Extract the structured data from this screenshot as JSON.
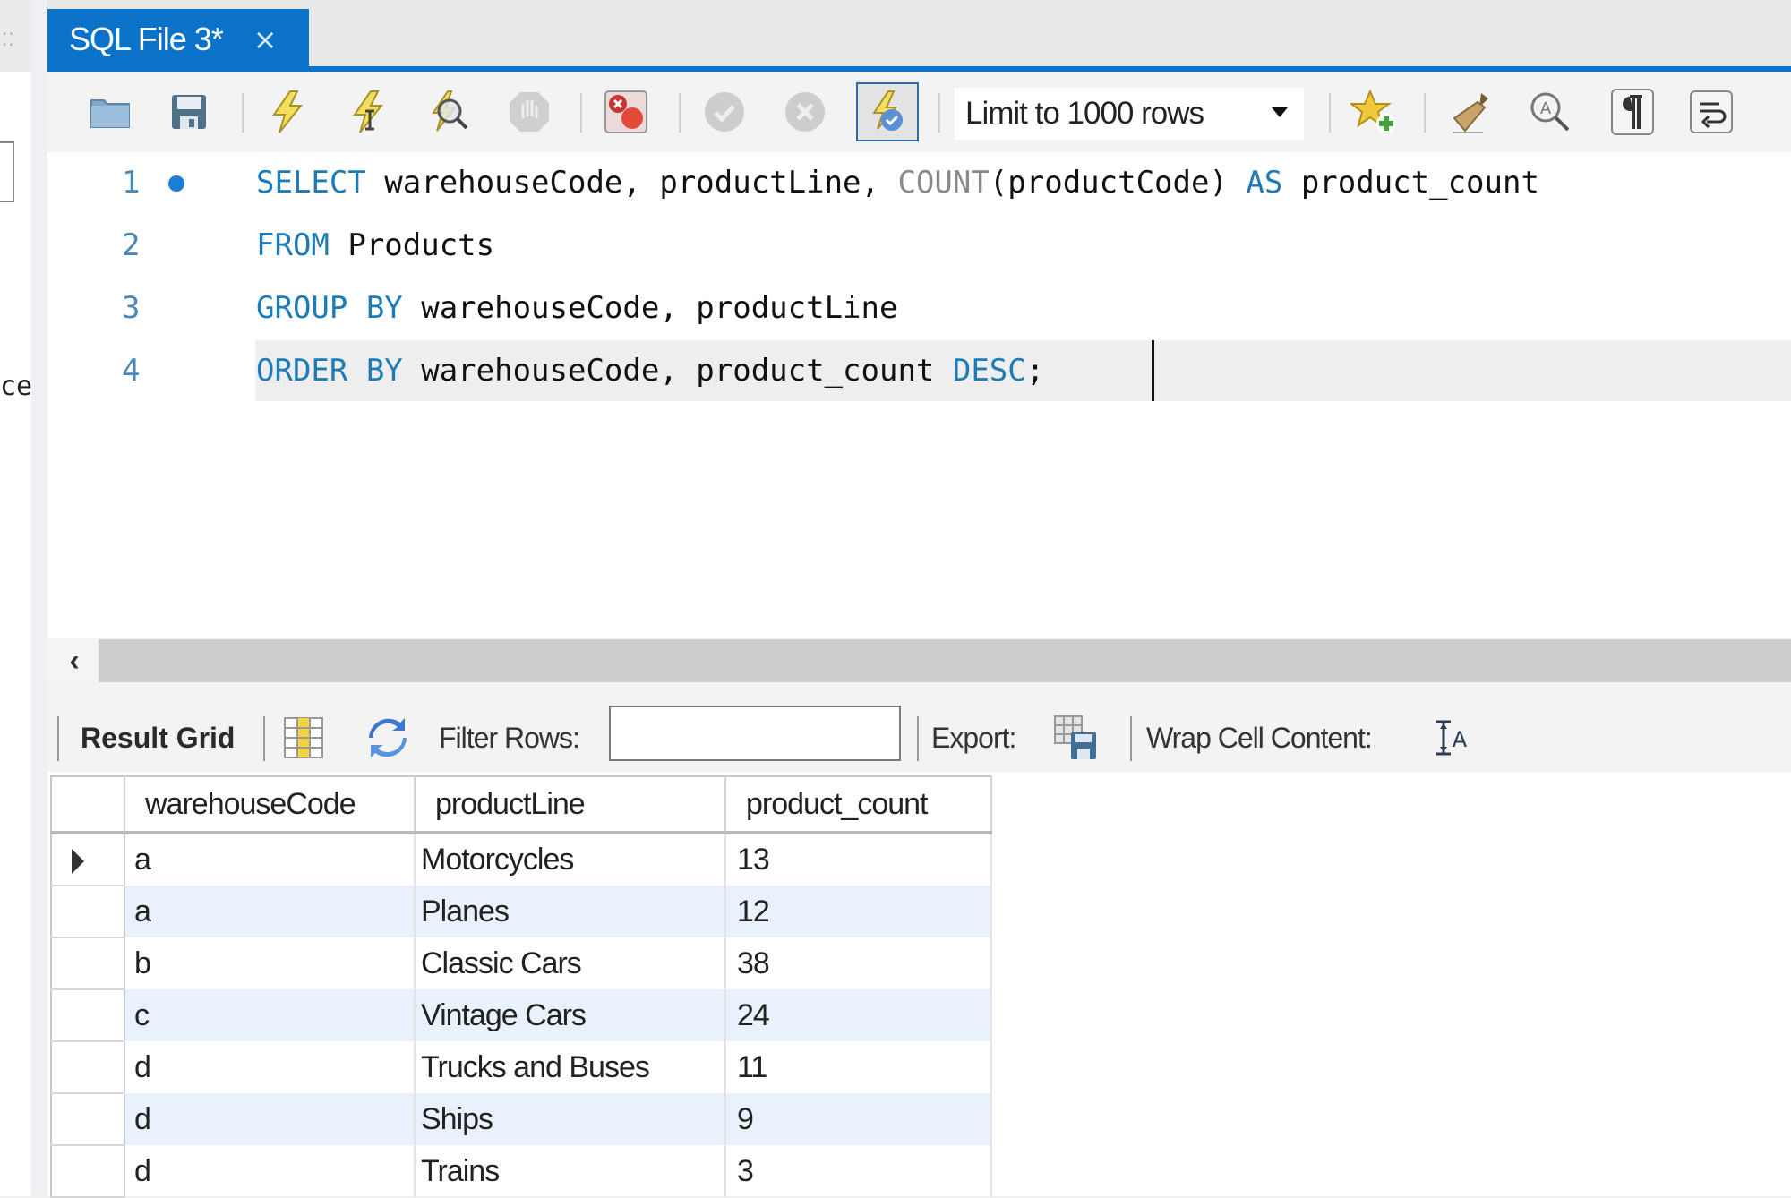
{
  "sidebar": {
    "grip": "⁚⁚",
    "partial_text": "ce"
  },
  "tab": {
    "title": "SQL File 3*",
    "close": "×"
  },
  "toolbar": {
    "icons": [
      "open-file-icon",
      "save-icon",
      "execute-icon",
      "execute-current-icon",
      "explain-icon",
      "stop-icon",
      "toggle-error-icon",
      "commit-icon",
      "rollback-icon",
      "autocommit-icon",
      "add-snippet-icon",
      "beautify-icon",
      "find-icon",
      "invisible-chars-icon",
      "word-wrap-icon"
    ],
    "limit_label": "Limit to 1000 rows"
  },
  "editor": {
    "line_numbers": [
      "1",
      "2",
      "3",
      "4"
    ],
    "lines": [
      [
        {
          "t": "SELECT",
          "c": "kw"
        },
        {
          "t": " warehouseCode, productLine, ",
          "c": ""
        },
        {
          "t": "COUNT",
          "c": "fn"
        },
        {
          "t": "(productCode) ",
          "c": ""
        },
        {
          "t": "AS",
          "c": "kw"
        },
        {
          "t": " product_count",
          "c": ""
        }
      ],
      [
        {
          "t": "FROM",
          "c": "kw"
        },
        {
          "t": " Products",
          "c": ""
        }
      ],
      [
        {
          "t": "GROUP BY",
          "c": "kw"
        },
        {
          "t": " warehouseCode, productLine",
          "c": ""
        }
      ],
      [
        {
          "t": "ORDER BY",
          "c": "kw"
        },
        {
          "t": " warehouseCode, product_count ",
          "c": ""
        },
        {
          "t": "DESC",
          "c": "kw"
        },
        {
          "t": ";",
          "c": ""
        }
      ]
    ]
  },
  "results": {
    "result_grid_label": "Result Grid",
    "filter_label": "Filter Rows:",
    "filter_value": "",
    "export_label": "Export:",
    "wrap_label": "Wrap Cell Content:",
    "columns": [
      "warehouseCode",
      "productLine",
      "product_count"
    ],
    "rows": [
      [
        "a",
        "Motorcycles",
        "13"
      ],
      [
        "a",
        "Planes",
        "12"
      ],
      [
        "b",
        "Classic Cars",
        "38"
      ],
      [
        "c",
        "Vintage Cars",
        "24"
      ],
      [
        "d",
        "Trucks and Buses",
        "11"
      ],
      [
        "d",
        "Ships",
        "9"
      ],
      [
        "d",
        "Trains",
        "3"
      ]
    ],
    "selected_row": 0
  },
  "colors": {
    "accent": "#0a73c9",
    "keyword": "#1d7bb5",
    "alt_row": "#e8f1fc"
  }
}
